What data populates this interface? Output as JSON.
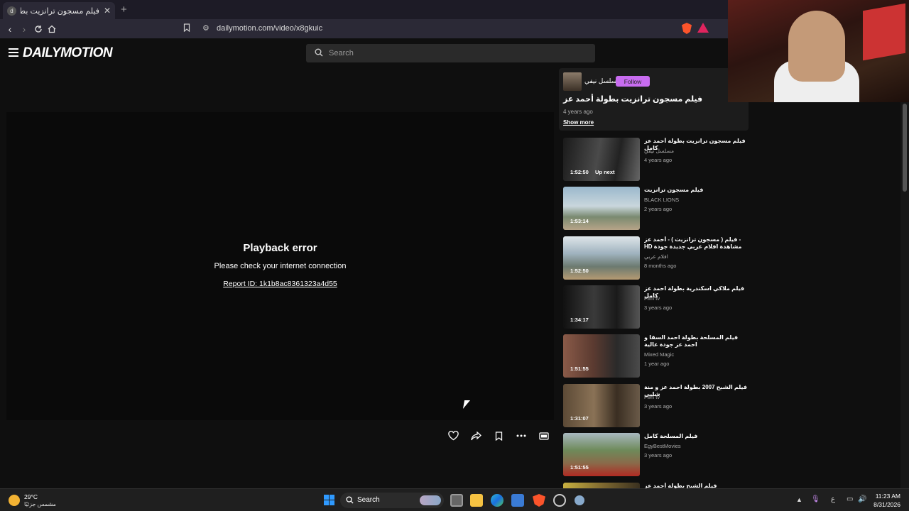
{
  "browser": {
    "tab_title": "فيلم مسجون ترانزيت بطولة أحمد ع",
    "new_tab": "+",
    "url": "dailymotion.com/video/x8gkuic"
  },
  "site": {
    "logo": "DAILYMOTION",
    "search_placeholder": "Search"
  },
  "player": {
    "error_title": "Playback error",
    "error_message": "Please check your internet connection",
    "report_id": "Report ID: 1k1b8ac8361323a4d55"
  },
  "video_info": {
    "channel_name": "مسلسل نيفي",
    "follow_label": "Follow",
    "title": "فيلم مسجون ترانزيت بطولة أحمد عز",
    "age": "4 years ago",
    "show_more": "Show more"
  },
  "related": [
    {
      "title": "فيلم مسجون ترانزيت بطولة أحمد عز كامل",
      "channel": "مسلسل نيفي",
      "age": "4 years ago",
      "duration": "1:52:50",
      "badge": "Up next"
    },
    {
      "title": "فيلم مسجون ترانزيت",
      "channel": "BLACK LIONS",
      "age": "2 years ago",
      "duration": "1:53:14",
      "badge": ""
    },
    {
      "title": "فيلم ( مسجون ترانزيت ) - أحمد عز - HD مشاهدة افلام عربي جديدة جودة",
      "channel": "افلام عربي",
      "age": "8 months ago",
      "duration": "1:52:50",
      "badge": ""
    },
    {
      "title": "فيلم ملاكي اسكندرية بطولة احمد عز كامل",
      "channel": "Film tv",
      "age": "3 years ago",
      "duration": "1:34:17",
      "badge": ""
    },
    {
      "title": "فيلم المسلحة بطولة احمد السقا و احمد عز جودة عالية",
      "channel": "Mixed Magic",
      "age": "1 year ago",
      "duration": "1:51:55",
      "badge": ""
    },
    {
      "title": "فيلم الشبح 2007 بطولة احمد عز و منة شلبي",
      "channel": "Film tv",
      "age": "3 years ago",
      "duration": "1:31:07",
      "badge": ""
    },
    {
      "title": "فيلم المسلحة كامل",
      "channel": "EgyBestMovies",
      "age": "3 years ago",
      "duration": "1:51:55",
      "badge": ""
    },
    {
      "title": "فيلم الشبح بطولة أحمد عز",
      "channel": "",
      "age": "",
      "duration": "",
      "badge": ""
    }
  ],
  "taskbar": {
    "weather_temp": "29°C",
    "weather_desc": "مشمس جزئيًا",
    "search_label": "Search",
    "lang": "ع",
    "time": "11:23 AM",
    "date": "8/31/2026"
  },
  "colors": {
    "follow": "#c86cf0",
    "background": "#0f0f0f",
    "brave": "#fb542b"
  }
}
